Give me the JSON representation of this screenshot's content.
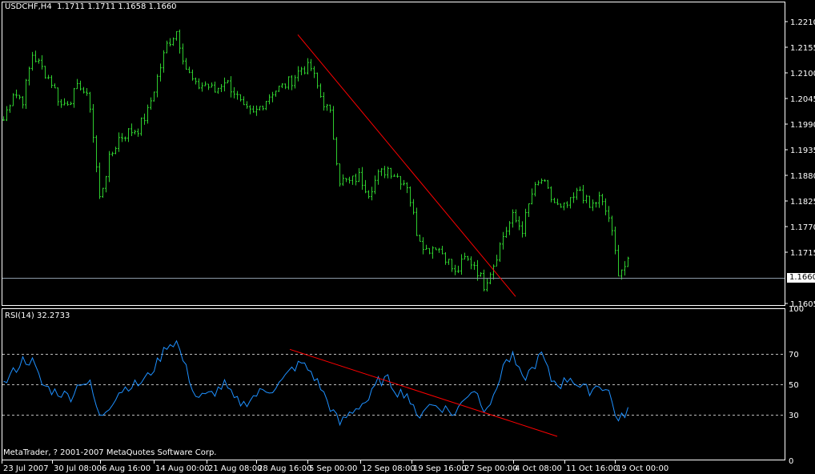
{
  "header": {
    "symbol": "USDCHF,H4",
    "ohlc": "1.1711 1.1711 1.1658 1.1660"
  },
  "rsi_header": {
    "label": "RSI(14)",
    "value": "32.2733"
  },
  "copyright": "MetaTrader, ? 2001-2007 MetaQuotes Software Corp.",
  "current_price": "1.1660",
  "colors": {
    "bars": "#2ecc2e",
    "rsi": "#1e90ff",
    "trendline": "#ff0000",
    "bid_line": "#8c9aa8"
  },
  "chart_data": [
    {
      "type": "bar",
      "title": "USDCHF,H4",
      "price_ticks": [
        "1.2210",
        "1.2155",
        "1.2100",
        "1.2045",
        "1.1990",
        "1.1935",
        "1.1880",
        "1.1825",
        "1.1770",
        "1.1715",
        "1.1605"
      ],
      "ylim": [
        1.16,
        1.224
      ],
      "sample_every_bars": 3,
      "closes": [
        1.1999,
        1.2059,
        1.2042,
        1.214,
        1.211,
        1.208,
        1.203,
        1.2045,
        1.2075,
        1.203,
        1.183,
        1.1913,
        1.196,
        1.1973,
        1.198,
        1.2016,
        1.209,
        1.216,
        1.219,
        1.211,
        1.207,
        1.2076,
        1.206,
        1.2085,
        1.206,
        1.202,
        1.201,
        1.2035,
        1.206,
        1.207,
        1.2085,
        1.211,
        1.211,
        1.205,
        1.201,
        1.187,
        1.1865,
        1.1878,
        1.1845,
        1.188,
        1.1895,
        1.1878,
        1.186,
        1.176,
        1.172,
        1.173,
        1.1706,
        1.1668,
        1.17,
        1.169,
        1.1645,
        1.169,
        1.175,
        1.179,
        1.1765,
        1.184,
        1.187,
        1.183,
        1.1805,
        1.182,
        1.185,
        1.181,
        1.183,
        1.179,
        1.1675,
        1.169
      ],
      "bid_line": 1.166,
      "trendline": {
        "from": {
          "bar": 92,
          "price": 1.2182
        },
        "to": {
          "bar": 160,
          "price": 1.162
        }
      }
    },
    {
      "type": "line",
      "title": "RSI(14)",
      "ylim": [
        0,
        100
      ],
      "levels": [
        70,
        50,
        30
      ],
      "tick_labels": [
        "100",
        "70",
        "50",
        "30",
        "0"
      ],
      "sample_every_bars": 3,
      "values": [
        50,
        58,
        66,
        65,
        50,
        46,
        44,
        42,
        52,
        50,
        28,
        36,
        45,
        49,
        50,
        55,
        64,
        76,
        78,
        60,
        42,
        42,
        45,
        50,
        40,
        37,
        42,
        46,
        47,
        52,
        60,
        64,
        58,
        48,
        35,
        24,
        31,
        36,
        40,
        52,
        53,
        45,
        44,
        28,
        36,
        36,
        34,
        30,
        42,
        47,
        35,
        40,
        63,
        68,
        53,
        60,
        70,
        53,
        50,
        55,
        48,
        46,
        50,
        45,
        25,
        34
      ],
      "trendline": {
        "from": {
          "bar": 89.5,
          "value": 73
        },
        "to": {
          "bar": 173,
          "value": 15.8
        }
      }
    }
  ],
  "time_labels": [
    "23 Jul 2007",
    "30 Jul 08:00",
    "6 Aug 16:00",
    "14 Aug 00:00",
    "21 Aug 08:00",
    "28 Aug 16:00",
    "5 Sep 00:00",
    "12 Sep 08:00",
    "19 Sep 16:00",
    "27 Sep 00:00",
    "4 Oct 08:00",
    "11 Oct 16:00",
    "19 Oct 00:00"
  ]
}
